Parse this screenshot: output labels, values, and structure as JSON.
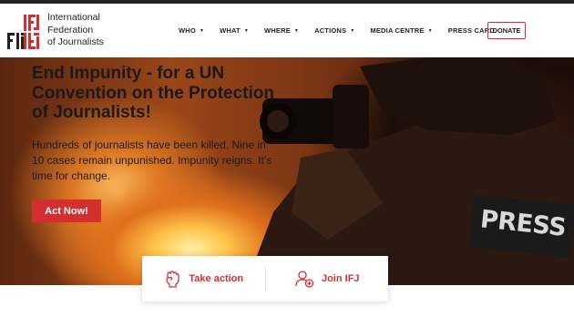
{
  "brand": {
    "logo_letters": "IFJ FIJ",
    "logo_color": "#d32f2f",
    "name_lines": [
      "International",
      "Federation",
      "of Journalists"
    ]
  },
  "nav": {
    "items": [
      {
        "label": "WHO",
        "caret": "▼"
      },
      {
        "label": "WHAT",
        "caret": "▼"
      },
      {
        "label": "WHERE",
        "caret": "▼"
      },
      {
        "label": "ACTIONS",
        "caret": "▼"
      },
      {
        "label": "MEDIA CENTRE",
        "caret": "▼"
      },
      {
        "label": "PRESS CARD",
        "caret": ""
      }
    ],
    "donate_label": "DONATE"
  },
  "hero": {
    "title": "End Impunity - for a UN Convention on the Protection of Journalists!",
    "text": "Hundreds of journalists have been killed. Nine in 10 cases remain unpunished. Impunity reigns. It’s time for change.",
    "button_label": "Act Now!",
    "vest_text": "PRESS"
  },
  "cta": {
    "take_action_label": "Take action",
    "join_label": "Join IFJ",
    "take_action_icon": "fist-icon",
    "join_icon": "user-add-icon"
  },
  "colors": {
    "accent": "#d32f2f",
    "text": "#222222"
  }
}
